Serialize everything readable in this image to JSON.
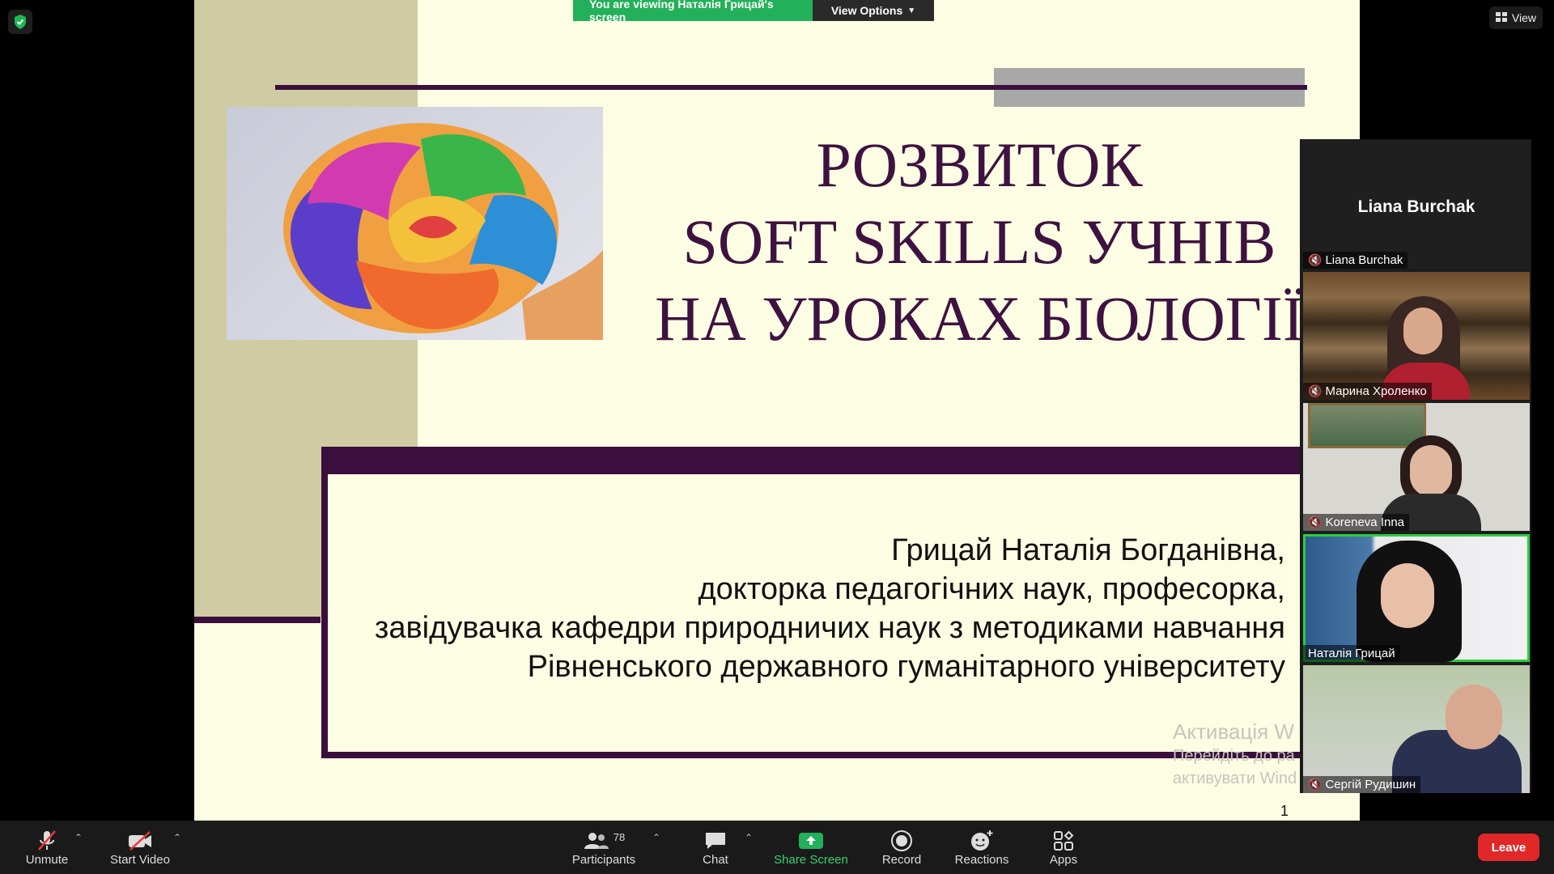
{
  "banner": {
    "message": "You are viewing Наталія Грицай's screen",
    "options_label": "View Options"
  },
  "view_label": "View",
  "slide": {
    "title_lines": [
      "РОЗВИТОК",
      "SOFT SKILLS УЧНІВ",
      "НА УРОКАХ БІОЛОГІЇ"
    ],
    "author_lines": [
      "Грицай Наталія Богданівна,",
      "докторка педагогічних наук, професорка,",
      "завідувачка кафедри природничих наук з методиками навчання",
      "Рівненського державного гуманітарного університету"
    ],
    "watermark": {
      "line1": "Активація W",
      "line2": "Перейдіть до ра",
      "line3": "активувати Wind"
    },
    "page_number": "1"
  },
  "participants": {
    "speaker_header": "Liana Burchak",
    "tiles": [
      {
        "name": "Liana Burchak",
        "muted": true
      },
      {
        "name": "Марина Хроленко",
        "muted": true
      },
      {
        "name": "Koreneva Inna",
        "muted": true
      },
      {
        "name": "Наталія Грицай",
        "muted": false
      },
      {
        "name": "Сергій Рудишин",
        "muted": true
      }
    ]
  },
  "toolbar": {
    "unmute": "Unmute",
    "start_video": "Start Video",
    "participants": "Participants",
    "participants_count": "78",
    "chat": "Chat",
    "share_screen": "Share Screen",
    "record": "Record",
    "reactions": "Reactions",
    "apps": "Apps",
    "leave": "Leave"
  },
  "colors": {
    "accent_green": "#23b05a",
    "slide_dark": "#3a0f3d",
    "leave_red": "#e02828"
  }
}
